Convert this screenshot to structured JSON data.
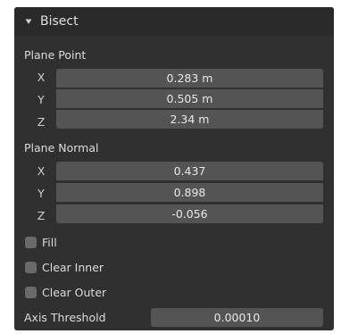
{
  "panel": {
    "title": "Bisect",
    "expanded_icon": "disclosure-triangle-down-icon"
  },
  "plane_point": {
    "label": "Plane Point",
    "x_label": "X",
    "y_label": "Y",
    "z_label": "Z",
    "x_value": "0.283 m",
    "y_value": "0.505 m",
    "z_value": "2.34 m"
  },
  "plane_normal": {
    "label": "Plane Normal",
    "x_label": "X",
    "y_label": "Y",
    "z_label": "Z",
    "x_value": "0.437",
    "y_value": "0.898",
    "z_value": "-0.056"
  },
  "options": {
    "fill_label": "Fill",
    "fill_checked": false,
    "clear_inner_label": "Clear Inner",
    "clear_inner_checked": false,
    "clear_outer_label": "Clear Outer",
    "clear_outer_checked": false
  },
  "axis_threshold": {
    "label": "Axis Threshold",
    "value": "0.00010"
  },
  "colors": {
    "panel_bg": "#303030",
    "header_bg": "#2a2a2a",
    "field_bg": "#545454",
    "checkbox_bg": "#6a6a6a",
    "text": "#dcdcdc"
  }
}
